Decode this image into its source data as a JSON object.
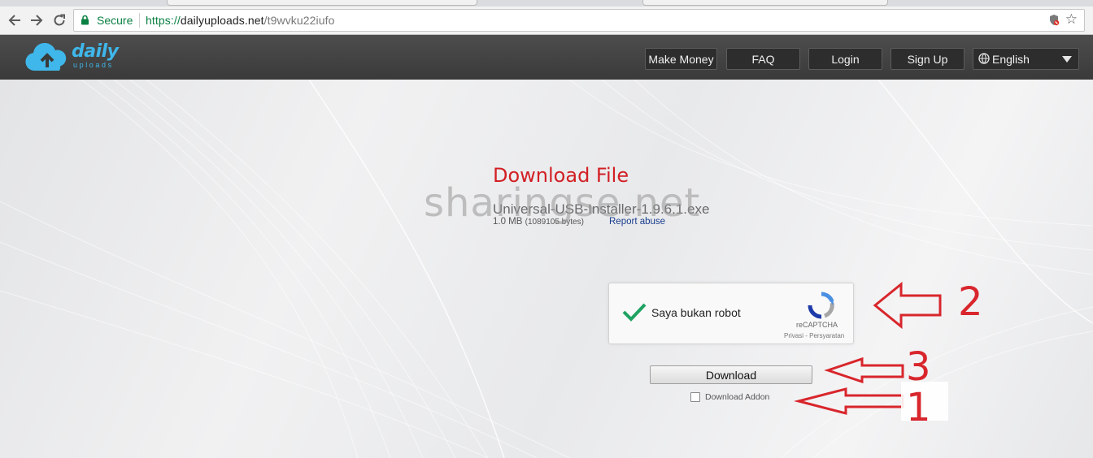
{
  "browser": {
    "secure_label": "Secure",
    "url_protocol": "https://",
    "url_host": "dailyuploads.net",
    "url_path": "/t9wvku22iufo"
  },
  "site": {
    "logo_text": "daily",
    "logo_subtext": "uploads",
    "nav": {
      "make_money": "Make Money",
      "faq": "FAQ",
      "login": "Login",
      "signup": "Sign Up"
    },
    "language": "English"
  },
  "file": {
    "heading": "Download File",
    "name": "Universal-USB-Installer-1.9.6.1.exe",
    "size": "1.0 MB",
    "bytes": "(1089105 bytes)",
    "report_link": "Report abuse"
  },
  "recaptcha": {
    "label": "Saya bukan robot",
    "brand": "reCAPTCHA",
    "links": "Privasi - Persyaratan"
  },
  "download": {
    "button_label": "Download",
    "addon_label": "Download Addon"
  },
  "watermark": "sharingse.net",
  "annotations": {
    "one": "1",
    "two": "2",
    "three": "3"
  },
  "colors": {
    "accent_red": "#d21f24",
    "brand_blue": "#3fb7ea",
    "header_bg": "#3f3f3f"
  }
}
